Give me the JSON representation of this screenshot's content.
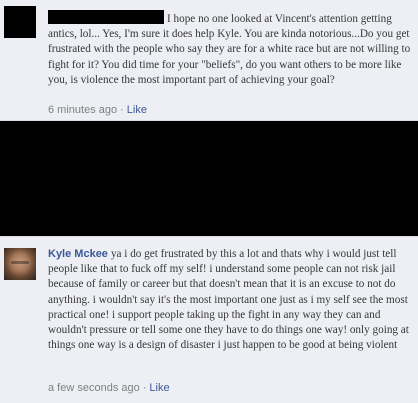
{
  "comments": [
    {
      "author": "",
      "text": "I hope no one looked at Vincent's attention getting antics, lol... Yes, I'm sure it does help Kyle. You are kinda notorious...Do you get frustrated with the people who say they are for a white race but are not willing to fight for it? You did time for your \"beliefs\", do you want others to be more like you, is violence the most important part of achieving your goal?",
      "timestamp": "6 minutes ago",
      "separator": "·",
      "like_label": "Like"
    },
    {
      "author": "Kyle Mckee",
      "text": "ya i do get frustrated by this a lot and thats why i would just tell people like that to fuck off my self! i understand some people can not risk jail because of family or career but that doesn't mean that it is an excuse to not do anything. i wouldn't say it's the most important one just as i my self see the most practical one! i support people taking up the fight in any way they can and wouldn't pressure or tell some one they have to do things one way! only going at things one way is a design of disaster i just happen to be good at being violent",
      "timestamp": "a few seconds ago",
      "separator": "·",
      "like_label": "Like"
    }
  ]
}
